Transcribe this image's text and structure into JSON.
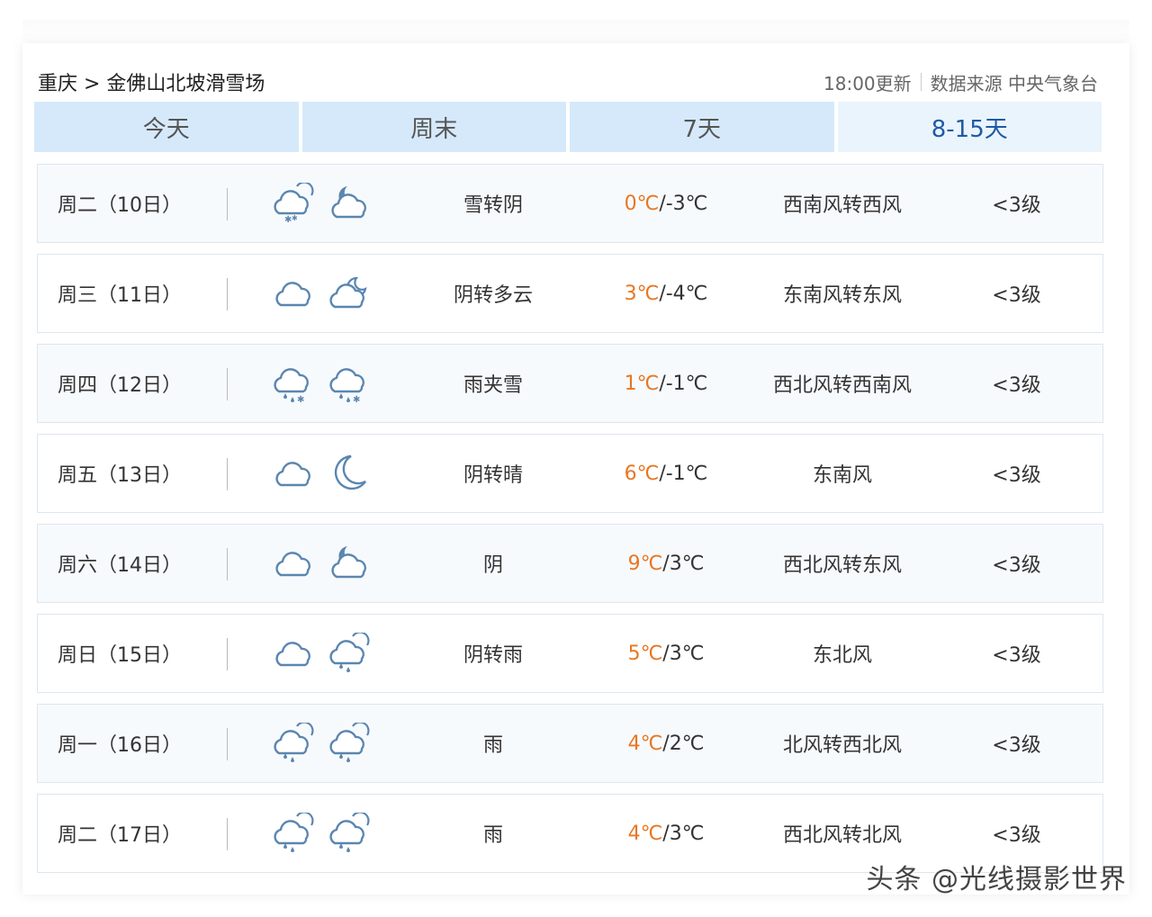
{
  "header": {
    "breadcrumb": "重庆 > 金佛山北坡滑雪场",
    "update_time": "18:00更新",
    "source": "数据来源 中央气象台"
  },
  "tabs": [
    {
      "label": "今天"
    },
    {
      "label": "周末"
    },
    {
      "label": "7天"
    },
    {
      "label": "8-15天",
      "active": true
    }
  ],
  "days": [
    {
      "date": "周二（10日）",
      "icon_day": "cloud-snow-icon",
      "icon_night": "moon-cloud-icon",
      "condition": "雪转阴",
      "high": "0℃",
      "low": "/-3℃",
      "wind": "西南风转西风",
      "level": "<3级"
    },
    {
      "date": "周三（11日）",
      "icon_day": "cloud-icon",
      "icon_night": "cloud-moon-icon",
      "condition": "阴转多云",
      "high": "3℃",
      "low": "/-4℃",
      "wind": "东南风转东风",
      "level": "<3级"
    },
    {
      "date": "周四（12日）",
      "icon_day": "sleet-icon",
      "icon_night": "sleet-icon",
      "condition": "雨夹雪",
      "high": "1℃",
      "low": "/-1℃",
      "wind": "西北风转西南风",
      "level": "<3级"
    },
    {
      "date": "周五（13日）",
      "icon_day": "cloud-icon",
      "icon_night": "moon-icon",
      "condition": "阴转晴",
      "high": "6℃",
      "low": "/-1℃",
      "wind": "东南风",
      "level": "<3级"
    },
    {
      "date": "周六（14日）",
      "icon_day": "cloud-icon",
      "icon_night": "moon-cloud-icon",
      "condition": "阴",
      "high": "9℃",
      "low": "/3℃",
      "wind": "西北风转东风",
      "level": "<3级"
    },
    {
      "date": "周日（15日）",
      "icon_day": "cloud-icon",
      "icon_night": "rain-cloud-icon",
      "condition": "阴转雨",
      "high": "5℃",
      "low": "/3℃",
      "wind": "东北风",
      "level": "<3级"
    },
    {
      "date": "周一（16日）",
      "icon_day": "rain-cloud-icon",
      "icon_night": "rain-cloud-icon",
      "condition": "雨",
      "high": "4℃",
      "low": "/2℃",
      "wind": "北风转西北风",
      "level": "<3级"
    },
    {
      "date": "周二（17日）",
      "icon_day": "rain-cloud-icon",
      "icon_night": "rain-cloud-icon",
      "condition": "雨",
      "high": "4℃",
      "low": "/3℃",
      "wind": "西北风转北风",
      "level": "<3级"
    }
  ],
  "colors": {
    "high_temp": "#e87722",
    "icon_stroke": "#5b86b0",
    "tab_bg": "#d6e9fb",
    "tab_active_text": "#1f5aa6"
  },
  "watermark": "头条 @光线摄影世界"
}
